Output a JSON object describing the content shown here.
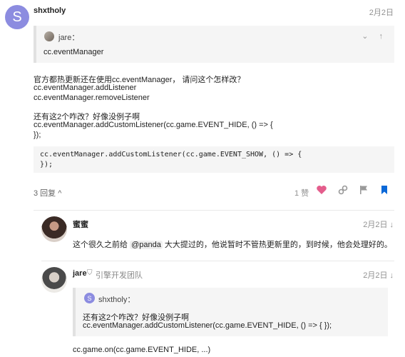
{
  "post": {
    "avatar_letter": "S",
    "author": "shxtholy",
    "date": "2月2日",
    "quote": {
      "name": "jare：",
      "text": "cc.eventManager",
      "icons": "⌄ ↑"
    },
    "body_lines": [
      "官方都热更新还在使用cc.eventManager， 请问这个怎样改？",
      "cc.eventManager.addListener",
      "cc.eventManager.removeListener",
      "还有这2个咋改？好像没例子啊",
      "cc.eventManager.addCustomListener(cc.game.EVENT_HIDE, () => {",
      "});"
    ],
    "code_lines": [
      "cc.eventManager.addCustomListener(cc.game.EVENT_SHOW, () => {",
      "});"
    ],
    "replies_label": "3 回复 ^",
    "likes_label": "1 赞",
    "heart_color": "#e45d8c",
    "bookmark_color": "#0a68d8"
  },
  "replies": [
    {
      "name": "蜜蜜",
      "date": "2月2日 ↓",
      "text_before": "这个很久之前给 ",
      "mention": "@panda",
      "text_after": " 大大提过的，他说暂时不管热更新里的，到时候，他会处理好的。"
    },
    {
      "name": "jare",
      "badge": "引擎开发团队",
      "date": "2月2日 ↓",
      "quote_avatar": "S",
      "quote_name": "shxtholy：",
      "quote_lines": [
        "还有这2个咋改？好像没例子啊",
        "cc.eventManager.addCustomListener(cc.game.EVENT_HIDE, () => { });"
      ],
      "text": "cc.game.on(cc.game.EVENT_HIDE, ...)"
    }
  ]
}
